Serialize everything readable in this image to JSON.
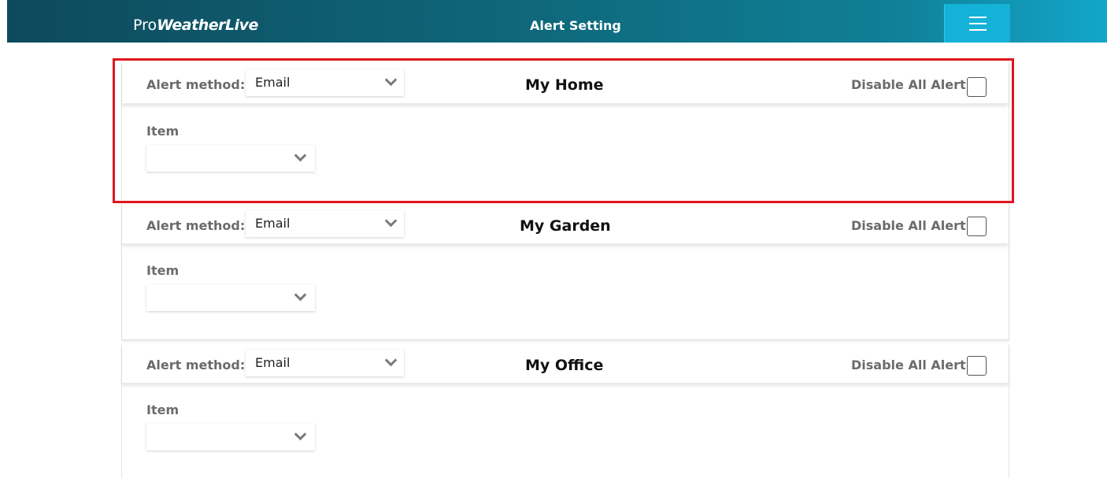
{
  "app": {
    "brand_prefix": "Pro",
    "brand_bold": "WeatherLive",
    "page_title": "Alert Setting",
    "menu_icon": "hamburger-menu-icon"
  },
  "stations": [
    {
      "name": "My Home",
      "alert_method_label": "Alert method:",
      "alert_method_value": "Email",
      "disable_label": "Disable All Alert",
      "disable_checked": false,
      "item_label": "Item",
      "item_value": ""
    },
    {
      "name": "My Garden",
      "alert_method_label": "Alert method:",
      "alert_method_value": "Email",
      "disable_label": "Disable All Alert",
      "disable_checked": false,
      "item_label": "Item",
      "item_value": ""
    },
    {
      "name": "My Office",
      "alert_method_label": "Alert method:",
      "alert_method_value": "Email",
      "disable_label": "Disable All Alert",
      "disable_checked": false,
      "item_label": "Item",
      "item_value": ""
    }
  ],
  "colors": {
    "highlight": "#e0151c",
    "topbar": "#0f6679",
    "menu_button": "#15b2d8"
  }
}
